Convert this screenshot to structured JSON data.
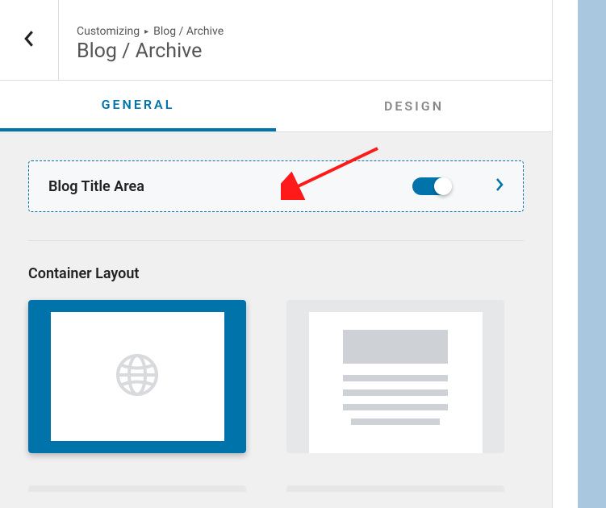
{
  "header": {
    "breadcrumb_root": "Customizing",
    "breadcrumb_current": "Blog / Archive",
    "title": "Blog / Archive"
  },
  "tabs": {
    "general": "GENERAL",
    "design": "DESIGN",
    "active": "general"
  },
  "settings": {
    "blog_title_area": {
      "label": "Blog Title Area",
      "enabled": true
    },
    "container_layout": {
      "label": "Container Layout",
      "selected": 0
    }
  },
  "icons": {
    "back": "chevron-left",
    "expand": "chevron-right",
    "layout_full": "globe"
  },
  "colors": {
    "accent": "#0073aa",
    "annotation": "#ff1a1a"
  }
}
